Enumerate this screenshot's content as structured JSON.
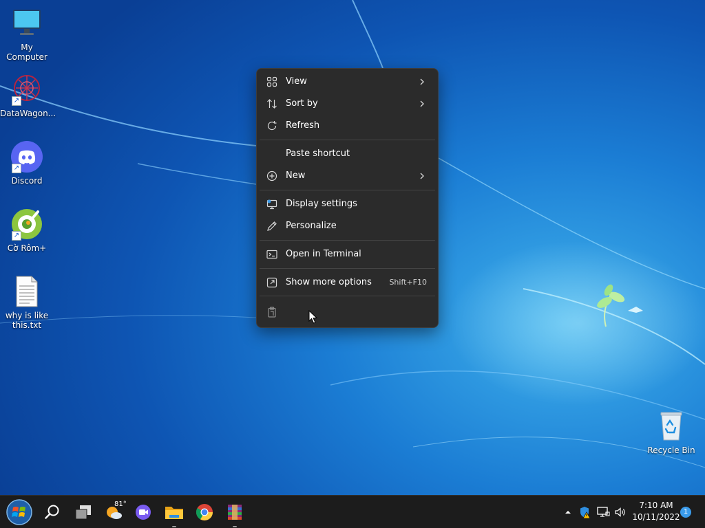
{
  "desktop": {
    "icons": [
      {
        "label": "My Computer",
        "icon": "monitor-icon",
        "shortcut": false
      },
      {
        "label": "DataWagon...",
        "icon": "datawagon-logo-icon",
        "shortcut": true
      },
      {
        "label": "Discord",
        "icon": "discord-icon",
        "shortcut": true
      },
      {
        "label": "Cờ Rôm+",
        "icon": "coc-coc-icon",
        "shortcut": true
      },
      {
        "label": "why is like this.txt",
        "icon": "text-file-icon",
        "shortcut": false
      },
      {
        "label": "Recycle Bin",
        "icon": "recycle-bin-icon",
        "shortcut": false
      }
    ]
  },
  "context_menu": {
    "items": [
      {
        "label": "View",
        "icon": "grid-view-icon",
        "submenu": true
      },
      {
        "label": "Sort by",
        "icon": "sort-arrows-icon",
        "submenu": true
      },
      {
        "label": "Refresh",
        "icon": "refresh-icon",
        "submenu": false
      },
      {
        "label": "Paste shortcut",
        "icon": "",
        "submenu": false
      },
      {
        "label": "New",
        "icon": "plus-circle-icon",
        "submenu": true
      },
      {
        "label": "Display settings",
        "icon": "display-settings-icon",
        "submenu": false
      },
      {
        "label": "Personalize",
        "icon": "pen-icon",
        "submenu": false
      },
      {
        "label": "Open in Terminal",
        "icon": "terminal-icon",
        "submenu": false
      },
      {
        "label": "Show more options",
        "icon": "more-options-icon",
        "submenu": false,
        "accelerator": "Shift+F10"
      }
    ],
    "bottom_actions": [
      {
        "icon": "paste-icon"
      }
    ]
  },
  "taskbar": {
    "apps": [
      {
        "name": "Start",
        "icon": "windows-orb-icon",
        "running": false
      },
      {
        "name": "Search",
        "icon": "search-icon",
        "running": false
      },
      {
        "name": "Task View",
        "icon": "task-view-icon",
        "running": false
      },
      {
        "name": "Weather",
        "icon": "weather-icon",
        "running": false
      },
      {
        "name": "Chat",
        "icon": "chat-icon",
        "running": false
      },
      {
        "name": "File Explorer",
        "icon": "folder-icon",
        "running": true
      },
      {
        "name": "Google Chrome",
        "icon": "chrome-icon",
        "running": false
      },
      {
        "name": "WinRAR",
        "icon": "winrar-icon",
        "running": true
      }
    ],
    "weather_temp": "81°",
    "tray": [
      "chevron-up-icon",
      "security-warning-icon",
      "network-icon",
      "volume-icon"
    ],
    "time": "7:10 AM",
    "date": "10/11/2022",
    "notification_count": "1"
  },
  "colors": {
    "menu_bg": "#2b2b2b",
    "taskbar_bg": "#1c1c1c",
    "accent": "#3a9bea",
    "desktop_mid": "#1b7dd4"
  }
}
